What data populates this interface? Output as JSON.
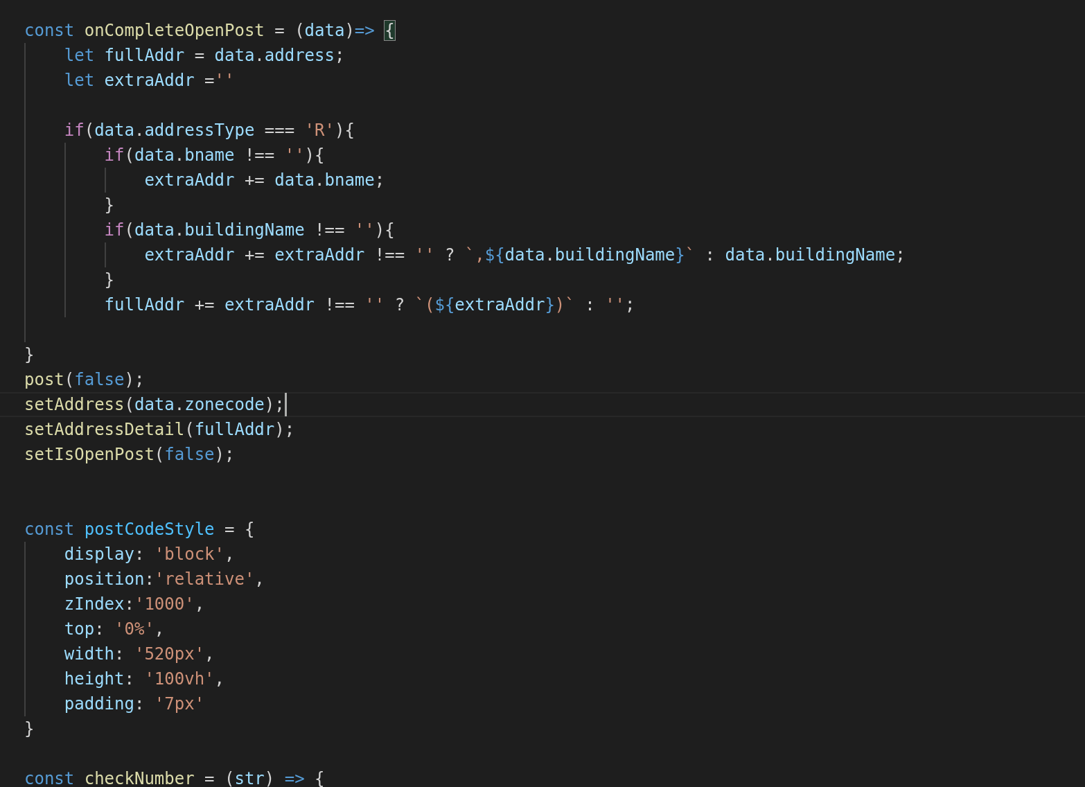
{
  "editor": {
    "lines": [
      {
        "current": false,
        "tokens": [
          {
            "text": "const ",
            "kind": "keyword"
          },
          {
            "text": "onCompleteOpenPost",
            "kind": "function"
          },
          {
            "text": " = (",
            "kind": "plain"
          },
          {
            "text": "data",
            "kind": "variable"
          },
          {
            "text": ")",
            "kind": "plain"
          },
          {
            "text": "=> ",
            "kind": "keyword"
          },
          {
            "text": "{",
            "kind": "match"
          }
        ]
      },
      {
        "current": false,
        "tokens": [
          {
            "text": "    let ",
            "kind": "keyword"
          },
          {
            "text": "fullAddr",
            "kind": "variable"
          },
          {
            "text": " = ",
            "kind": "plain"
          },
          {
            "text": "data",
            "kind": "variable"
          },
          {
            "text": ".",
            "kind": "plain"
          },
          {
            "text": "address",
            "kind": "variable"
          },
          {
            "text": ";",
            "kind": "plain"
          }
        ]
      },
      {
        "current": false,
        "tokens": [
          {
            "text": "    let ",
            "kind": "keyword"
          },
          {
            "text": "extraAddr",
            "kind": "variable"
          },
          {
            "text": " =",
            "kind": "plain"
          },
          {
            "text": "''",
            "kind": "string"
          }
        ]
      },
      {
        "current": false
      },
      {
        "current": false,
        "tokens": [
          {
            "text": "    if",
            "kind": "control"
          },
          {
            "text": "(",
            "kind": "plain"
          },
          {
            "text": "data",
            "kind": "variable"
          },
          {
            "text": ".",
            "kind": "plain"
          },
          {
            "text": "addressType",
            "kind": "variable"
          },
          {
            "text": " === ",
            "kind": "plain"
          },
          {
            "text": "'R'",
            "kind": "string"
          },
          {
            "text": "){",
            "kind": "plain"
          }
        ]
      },
      {
        "current": false,
        "tokens": [
          {
            "text": "        if",
            "kind": "control"
          },
          {
            "text": "(",
            "kind": "plain"
          },
          {
            "text": "data",
            "kind": "variable"
          },
          {
            "text": ".",
            "kind": "plain"
          },
          {
            "text": "bname",
            "kind": "variable"
          },
          {
            "text": " !== ",
            "kind": "plain"
          },
          {
            "text": "''",
            "kind": "string"
          },
          {
            "text": "){",
            "kind": "plain"
          }
        ]
      },
      {
        "current": false,
        "tokens": [
          {
            "text": "            extraAddr",
            "kind": "variable"
          },
          {
            "text": " += ",
            "kind": "plain"
          },
          {
            "text": "data",
            "kind": "variable"
          },
          {
            "text": ".",
            "kind": "plain"
          },
          {
            "text": "bname",
            "kind": "variable"
          },
          {
            "text": ";",
            "kind": "plain"
          }
        ]
      },
      {
        "current": false,
        "tokens": [
          {
            "text": "        }",
            "kind": "plain"
          }
        ]
      },
      {
        "current": false,
        "tokens": [
          {
            "text": "        if",
            "kind": "control"
          },
          {
            "text": "(",
            "kind": "plain"
          },
          {
            "text": "data",
            "kind": "variable"
          },
          {
            "text": ".",
            "kind": "plain"
          },
          {
            "text": "buildingName",
            "kind": "variable"
          },
          {
            "text": " !== ",
            "kind": "plain"
          },
          {
            "text": "''",
            "kind": "string"
          },
          {
            "text": "){",
            "kind": "plain"
          }
        ]
      },
      {
        "current": false,
        "tokens": [
          {
            "text": "            extraAddr",
            "kind": "variable"
          },
          {
            "text": " += ",
            "kind": "plain"
          },
          {
            "text": "extraAddr",
            "kind": "variable"
          },
          {
            "text": " !== ",
            "kind": "plain"
          },
          {
            "text": "''",
            "kind": "string"
          },
          {
            "text": " ? ",
            "kind": "plain"
          },
          {
            "text": "`,",
            "kind": "string"
          },
          {
            "text": "${",
            "kind": "keyword"
          },
          {
            "text": "data",
            "kind": "variable"
          },
          {
            "text": ".",
            "kind": "plain"
          },
          {
            "text": "buildingName",
            "kind": "variable"
          },
          {
            "text": "}",
            "kind": "keyword"
          },
          {
            "text": "`",
            "kind": "string"
          },
          {
            "text": " : ",
            "kind": "plain"
          },
          {
            "text": "data",
            "kind": "variable"
          },
          {
            "text": ".",
            "kind": "plain"
          },
          {
            "text": "buildingName",
            "kind": "variable"
          },
          {
            "text": ";",
            "kind": "plain"
          }
        ]
      },
      {
        "current": false,
        "tokens": [
          {
            "text": "        }",
            "kind": "plain"
          }
        ]
      },
      {
        "current": false,
        "tokens": [
          {
            "text": "        fullAddr",
            "kind": "variable"
          },
          {
            "text": " += ",
            "kind": "plain"
          },
          {
            "text": "extraAddr",
            "kind": "variable"
          },
          {
            "text": " !== ",
            "kind": "plain"
          },
          {
            "text": "''",
            "kind": "string"
          },
          {
            "text": " ? ",
            "kind": "plain"
          },
          {
            "text": "`(",
            "kind": "string"
          },
          {
            "text": "${",
            "kind": "keyword"
          },
          {
            "text": "extraAddr",
            "kind": "variable"
          },
          {
            "text": "}",
            "kind": "keyword"
          },
          {
            "text": ")`",
            "kind": "string"
          },
          {
            "text": " : ",
            "kind": "plain"
          },
          {
            "text": "''",
            "kind": "string"
          },
          {
            "text": ";",
            "kind": "plain"
          }
        ]
      },
      {
        "current": false
      },
      {
        "current": false,
        "tokens": [
          {
            "text": "}",
            "kind": "plain"
          }
        ]
      },
      {
        "current": false,
        "tokens": [
          {
            "text": "post",
            "kind": "function"
          },
          {
            "text": "(",
            "kind": "plain"
          },
          {
            "text": "false",
            "kind": "keyword"
          },
          {
            "text": ");",
            "kind": "plain"
          }
        ]
      },
      {
        "current": true,
        "tokens": [
          {
            "text": "setAddress",
            "kind": "function"
          },
          {
            "text": "(",
            "kind": "plain"
          },
          {
            "text": "data",
            "kind": "variable"
          },
          {
            "text": ".",
            "kind": "plain"
          },
          {
            "text": "zonecode",
            "kind": "variable"
          },
          {
            "text": ");",
            "kind": "plain"
          }
        ]
      },
      {
        "current": false,
        "tokens": [
          {
            "text": "setAddressDetail",
            "kind": "function"
          },
          {
            "text": "(",
            "kind": "plain"
          },
          {
            "text": "fullAddr",
            "kind": "variable"
          },
          {
            "text": ");",
            "kind": "plain"
          }
        ]
      },
      {
        "current": false,
        "tokens": [
          {
            "text": "setIsOpenPost",
            "kind": "function"
          },
          {
            "text": "(",
            "kind": "plain"
          },
          {
            "text": "false",
            "kind": "keyword"
          },
          {
            "text": ");",
            "kind": "plain"
          }
        ]
      },
      {
        "current": false
      },
      {
        "current": false
      },
      {
        "current": false,
        "tokens": [
          {
            "text": "const ",
            "kind": "keyword"
          },
          {
            "text": "postCodeStyle",
            "kind": "constant"
          },
          {
            "text": " = {",
            "kind": "plain"
          }
        ]
      },
      {
        "current": false,
        "tokens": [
          {
            "text": "    display",
            "kind": "variable"
          },
          {
            "text": ": ",
            "kind": "plain"
          },
          {
            "text": "'block'",
            "kind": "string"
          },
          {
            "text": ",",
            "kind": "plain"
          }
        ]
      },
      {
        "current": false,
        "tokens": [
          {
            "text": "    position",
            "kind": "variable"
          },
          {
            "text": ":",
            "kind": "plain"
          },
          {
            "text": "'relative'",
            "kind": "string"
          },
          {
            "text": ",",
            "kind": "plain"
          }
        ]
      },
      {
        "current": false,
        "tokens": [
          {
            "text": "    zIndex",
            "kind": "variable"
          },
          {
            "text": ":",
            "kind": "plain"
          },
          {
            "text": "'1000'",
            "kind": "string"
          },
          {
            "text": ",",
            "kind": "plain"
          }
        ]
      },
      {
        "current": false,
        "tokens": [
          {
            "text": "    top",
            "kind": "variable"
          },
          {
            "text": ": ",
            "kind": "plain"
          },
          {
            "text": "'0%'",
            "kind": "string"
          },
          {
            "text": ",",
            "kind": "plain"
          }
        ]
      },
      {
        "current": false,
        "tokens": [
          {
            "text": "    width",
            "kind": "variable"
          },
          {
            "text": ": ",
            "kind": "plain"
          },
          {
            "text": "'520px'",
            "kind": "string"
          },
          {
            "text": ",",
            "kind": "plain"
          }
        ]
      },
      {
        "current": false,
        "tokens": [
          {
            "text": "    height",
            "kind": "variable"
          },
          {
            "text": ": ",
            "kind": "plain"
          },
          {
            "text": "'100vh'",
            "kind": "string"
          },
          {
            "text": ",",
            "kind": "plain"
          }
        ]
      },
      {
        "current": false,
        "tokens": [
          {
            "text": "    padding",
            "kind": "variable"
          },
          {
            "text": ": ",
            "kind": "plain"
          },
          {
            "text": "'7px'",
            "kind": "string"
          }
        ]
      },
      {
        "current": false,
        "tokens": [
          {
            "text": "}",
            "kind": "plain"
          }
        ]
      },
      {
        "current": false
      },
      {
        "current": false,
        "tokens": [
          {
            "text": "const ",
            "kind": "keyword"
          },
          {
            "text": "checkNumber",
            "kind": "function"
          },
          {
            "text": " = (",
            "kind": "plain"
          },
          {
            "text": "str",
            "kind": "variable"
          },
          {
            "text": ") ",
            "kind": "plain"
          },
          {
            "text": "=> ",
            "kind": "keyword"
          },
          {
            "text": "{",
            "kind": "plain"
          }
        ]
      }
    ]
  }
}
